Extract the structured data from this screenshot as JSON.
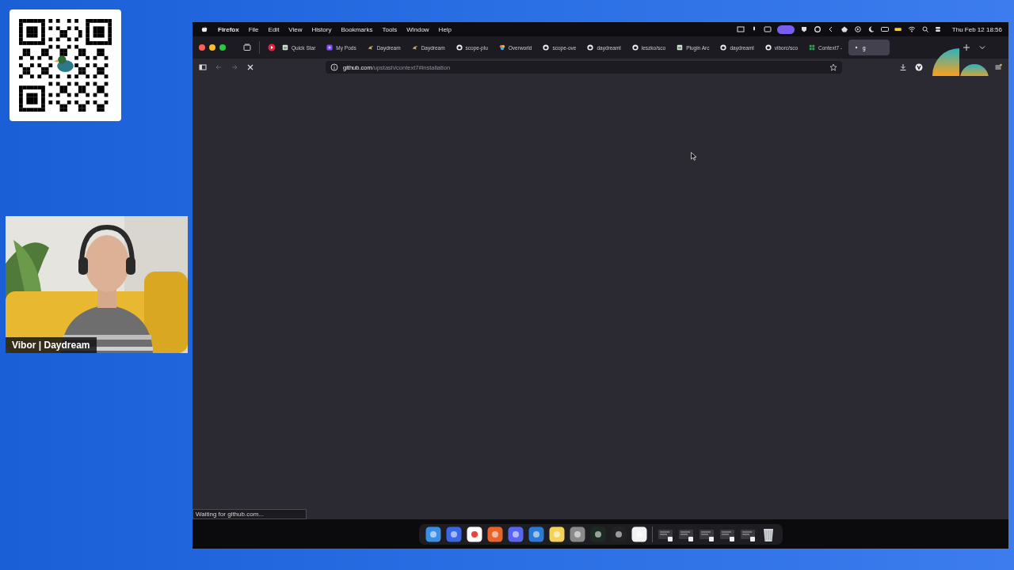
{
  "overlay": {
    "caption": "Vibor | Daydream"
  },
  "menu_bar": {
    "app": "Firefox",
    "items": [
      "File",
      "Edit",
      "View",
      "History",
      "Bookmarks",
      "Tools",
      "Window",
      "Help"
    ],
    "clock": "Thu Feb 12 18:56"
  },
  "tabs": [
    {
      "label": "Quick Star",
      "kind": "page",
      "selected": false
    },
    {
      "label": "My Pods",
      "kind": "pods",
      "selected": false
    },
    {
      "label": "Daydream",
      "kind": "bird",
      "selected": false
    },
    {
      "label": "Daydream",
      "kind": "bird",
      "selected": false
    },
    {
      "label": "scope-plu",
      "kind": "github",
      "selected": false
    },
    {
      "label": "Overworld",
      "kind": "flower",
      "selected": false
    },
    {
      "label": "scope-ove",
      "kind": "github",
      "selected": false
    },
    {
      "label": "daydreaml",
      "kind": "github",
      "selected": false
    },
    {
      "label": "leszko/sco",
      "kind": "github",
      "selected": false
    },
    {
      "label": "Plugin Arc",
      "kind": "page",
      "selected": false
    },
    {
      "label": "daydreaml",
      "kind": "github",
      "selected": false
    },
    {
      "label": "viborc/sco",
      "kind": "github",
      "selected": false
    },
    {
      "label": "Context7 -",
      "kind": "grid",
      "selected": false
    },
    {
      "label": "g",
      "kind": "dot",
      "selected": true
    }
  ],
  "address_bar": {
    "host": "github.com",
    "path": "/upstash/context7#installation"
  },
  "status_bar": {
    "text": "Waiting for github.com..."
  }
}
